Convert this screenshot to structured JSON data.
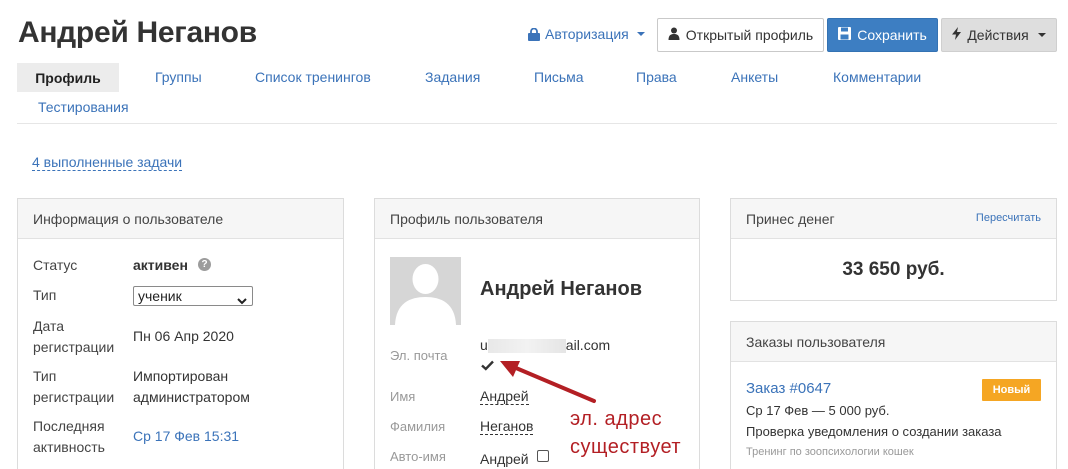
{
  "header": {
    "title": "Андрей Неганов",
    "auth_label": "Авторизация",
    "open_profile_label": "Открытый профиль",
    "save_label": "Сохранить",
    "actions_label": "Действия"
  },
  "tabs": [
    {
      "label": "Профиль"
    },
    {
      "label": "Группы"
    },
    {
      "label": "Список тренингов"
    },
    {
      "label": "Задания"
    },
    {
      "label": "Письма"
    },
    {
      "label": "Права"
    },
    {
      "label": "Анкеты"
    },
    {
      "label": "Комментарии"
    },
    {
      "label": "Тестирования"
    }
  ],
  "tasks_link": "4 выполненные задачи",
  "user_info": {
    "title": "Информация о пользователе",
    "status_label": "Статус",
    "status_value": "активен",
    "type_label": "Тип",
    "type_value": "ученик",
    "reg_date_label_1": "Дата",
    "reg_date_label_2": "регистрации",
    "reg_date_value": "Пн 06 Апр 2020",
    "reg_type_label_1": "Тип",
    "reg_type_label_2": "регистрации",
    "reg_type_value_1": "Импортирован",
    "reg_type_value_2": "администратором",
    "last_activity_label_1": "Последняя",
    "last_activity_label_2": "активность",
    "last_activity_value": "Ср 17 Фев 15:31"
  },
  "profile": {
    "title": "Профиль пользователя",
    "name": "Андрей Неганов",
    "email_label": "Эл. почта",
    "email_prefix": "u",
    "email_suffix": "ail.com",
    "first_name_label": "Имя",
    "first_name_value": "Андрей",
    "last_name_label": "Фамилия",
    "last_name_value": "Неганов",
    "auto_name_label": "Авто-имя",
    "auto_name_value": "Андрей"
  },
  "money": {
    "title": "Принес денег",
    "recalc_label": "Пересчитать",
    "amount": "33 650 руб."
  },
  "orders": {
    "title": "Заказы пользователя",
    "order_title": "Заказ #0647",
    "badge": "Новый",
    "order_date": "Ср 17 Фев — 5 000 руб.",
    "order_desc": "Проверка уведомления о создании заказа",
    "order_training": "Тренинг по зоопсихологии кошек"
  },
  "annotation": {
    "line1": "эл. адрес",
    "line2": "существует"
  },
  "colors": {
    "link": "#3b73b9",
    "save_button": "#3d7ec2",
    "badge": "#f5a623",
    "annotation": "#b31f24"
  }
}
